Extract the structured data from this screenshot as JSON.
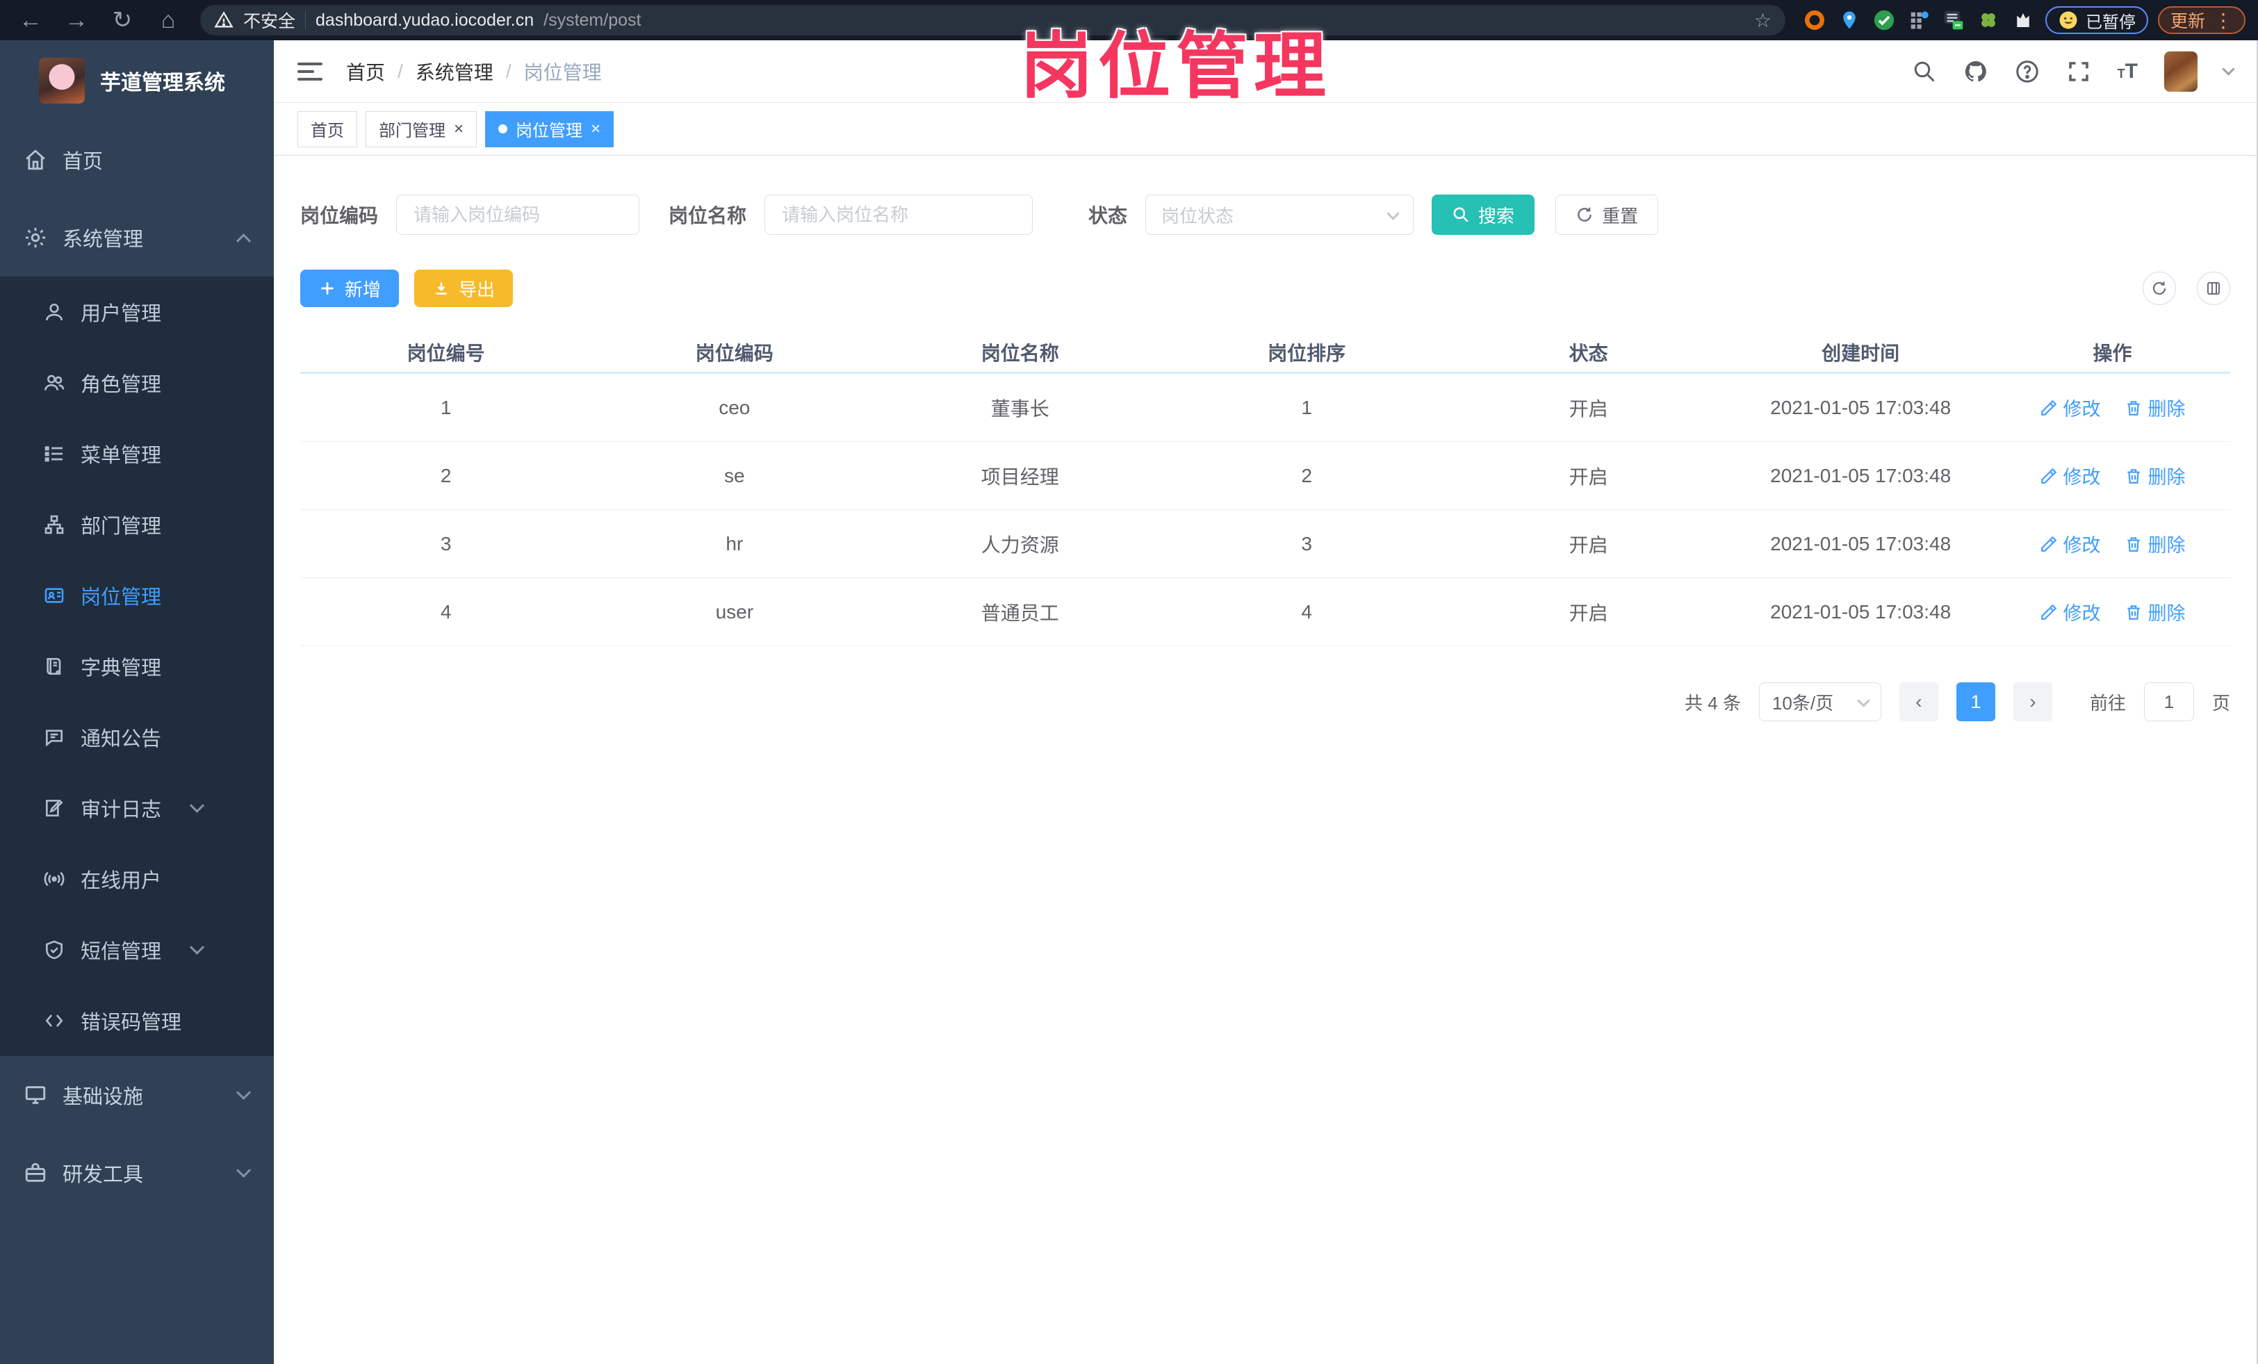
{
  "browser": {
    "security_label": "不安全",
    "url_host": "dashboard.yudao.iocoder.cn",
    "url_path": "/system/post",
    "paused_badge_label": "已暂停",
    "update_label": "更新"
  },
  "watermark_text": "岗位管理",
  "sidebar": {
    "logo_title": "芋道管理系统",
    "top_items": [
      {
        "label": "首页"
      },
      {
        "label": "系统管理"
      }
    ],
    "submenu_items": [
      {
        "label": "用户管理"
      },
      {
        "label": "角色管理"
      },
      {
        "label": "菜单管理"
      },
      {
        "label": "部门管理"
      },
      {
        "label": "岗位管理"
      },
      {
        "label": "字典管理"
      },
      {
        "label": "通知公告"
      },
      {
        "label": "审计日志"
      },
      {
        "label": "在线用户"
      },
      {
        "label": "短信管理"
      },
      {
        "label": "错误码管理"
      }
    ],
    "bottom_items": [
      {
        "label": "基础设施"
      },
      {
        "label": "研发工具"
      }
    ]
  },
  "header": {
    "breadcrumb": [
      "首页",
      "系统管理",
      "岗位管理"
    ]
  },
  "tabs": [
    {
      "label": "首页"
    },
    {
      "label": "部门管理"
    },
    {
      "label": "岗位管理"
    }
  ],
  "filters": {
    "post_code_label": "岗位编码",
    "post_code_placeholder": "请输入岗位编码",
    "post_name_label": "岗位名称",
    "post_name_placeholder": "请输入岗位名称",
    "status_label": "状态",
    "status_placeholder": "岗位状态",
    "search_label": "搜索",
    "reset_label": "重置"
  },
  "toolbar": {
    "add_label": "新增",
    "export_label": "导出"
  },
  "table": {
    "headers": [
      "岗位编号",
      "岗位编码",
      "岗位名称",
      "岗位排序",
      "状态",
      "创建时间",
      "操作"
    ],
    "edit_label": "修改",
    "delete_label": "删除",
    "rows": [
      {
        "id": "1",
        "code": "ceo",
        "name": "董事长",
        "sort": "1",
        "status": "开启",
        "created": "2021-01-05 17:03:48"
      },
      {
        "id": "2",
        "code": "se",
        "name": "项目经理",
        "sort": "2",
        "status": "开启",
        "created": "2021-01-05 17:03:48"
      },
      {
        "id": "3",
        "code": "hr",
        "name": "人力资源",
        "sort": "3",
        "status": "开启",
        "created": "2021-01-05 17:03:48"
      },
      {
        "id": "4",
        "code": "user",
        "name": "普通员工",
        "sort": "4",
        "status": "开启",
        "created": "2021-01-05 17:03:48"
      }
    ]
  },
  "pagination": {
    "total_text": "共 4 条",
    "page_size": "10条/页",
    "current_page": "1",
    "goto_label": "前往",
    "goto_value": "1",
    "page_unit": "页"
  },
  "colors": {
    "primary": "#409EFF",
    "search_teal": "#26c0b4",
    "export_orange": "#f7ba2a",
    "watermark_pink": "#f5365f",
    "sidebar_bg": "#304156",
    "submenu_bg": "#1f2d3d"
  }
}
